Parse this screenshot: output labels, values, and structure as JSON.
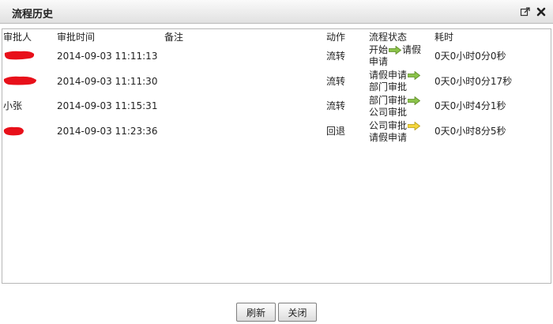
{
  "dialog": {
    "title": "流程历史",
    "popout_icon": "popout-icon",
    "close_icon": "close-icon"
  },
  "table": {
    "columns": [
      "审批人",
      "审批时间",
      "备注",
      "动作",
      "流程状态",
      "耗时"
    ],
    "rows": [
      {
        "approver": "",
        "approver_redacted": true,
        "time": "2014-09-03 11:11:13",
        "note": "",
        "action": "流转",
        "state_from": "开始",
        "state_to": "请假申请",
        "arrow_color": "#8bc34a",
        "duration": "0天0小时0分0秒"
      },
      {
        "approver": "",
        "approver_redacted": true,
        "time": "2014-09-03 11:11:30",
        "note": "",
        "action": "流转",
        "state_from": "请假申请",
        "state_to": "部门审批",
        "arrow_color": "#8bc34a",
        "duration": "0天0小时0分17秒"
      },
      {
        "approver": "小张",
        "approver_redacted": false,
        "time": "2014-09-03 11:15:31",
        "note": "",
        "action": "流转",
        "state_from": "部门审批",
        "state_to": "公司审批",
        "arrow_color": "#8bc34a",
        "duration": "0天0小时4分1秒"
      },
      {
        "approver": "",
        "approver_redacted": true,
        "time": "2014-09-03 11:23:36",
        "note": "",
        "action": "回退",
        "state_from": "公司审批",
        "state_to": "请假申请",
        "arrow_color": "#f5d63d",
        "duration": "0天0小时8分5秒"
      }
    ]
  },
  "footer": {
    "refresh_label": "刷新",
    "close_label": "关闭"
  },
  "colors": {
    "redaction": "#e8101a",
    "arrow_forward": "#8bc34a",
    "arrow_back": "#f5d63d"
  }
}
